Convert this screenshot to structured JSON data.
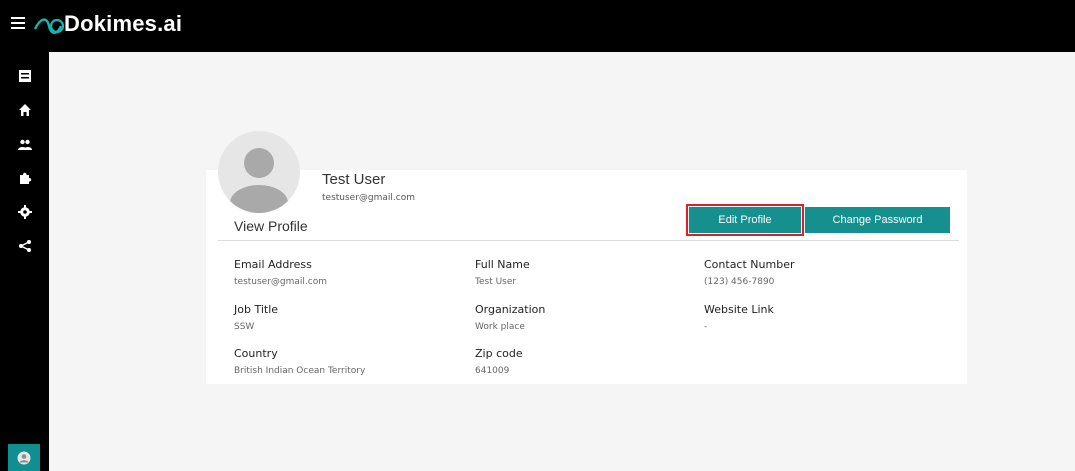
{
  "app": {
    "brand": "Dokimes.ai"
  },
  "sidebar": {
    "icons": [
      "dashboard-icon",
      "home-icon",
      "people-icon",
      "extension-icon",
      "settings-icon",
      "share-icon"
    ],
    "accent": "#0f8f8f"
  },
  "profile": {
    "name": "Test User",
    "email": "testuser@gmail.com",
    "section_title": "View Profile",
    "edit_label": "Edit Profile",
    "change_password_label": "Change Password",
    "fields": {
      "email_label": "Email Address",
      "email_value": "testuser@gmail.com",
      "fullname_label": "Full Name",
      "fullname_value": "Test User",
      "contact_label": "Contact Number",
      "contact_value": "(123) 456-7890",
      "job_label": "Job Title",
      "job_value": "SSW",
      "org_label": "Organization",
      "org_value": "Work place",
      "website_label": "Website Link",
      "website_value": "-",
      "country_label": "Country",
      "country_value": "British Indian Ocean Territory",
      "zip_label": "Zip code",
      "zip_value": "641009"
    }
  },
  "colors": {
    "primary": "#15908f",
    "highlight": "#d9202b"
  }
}
